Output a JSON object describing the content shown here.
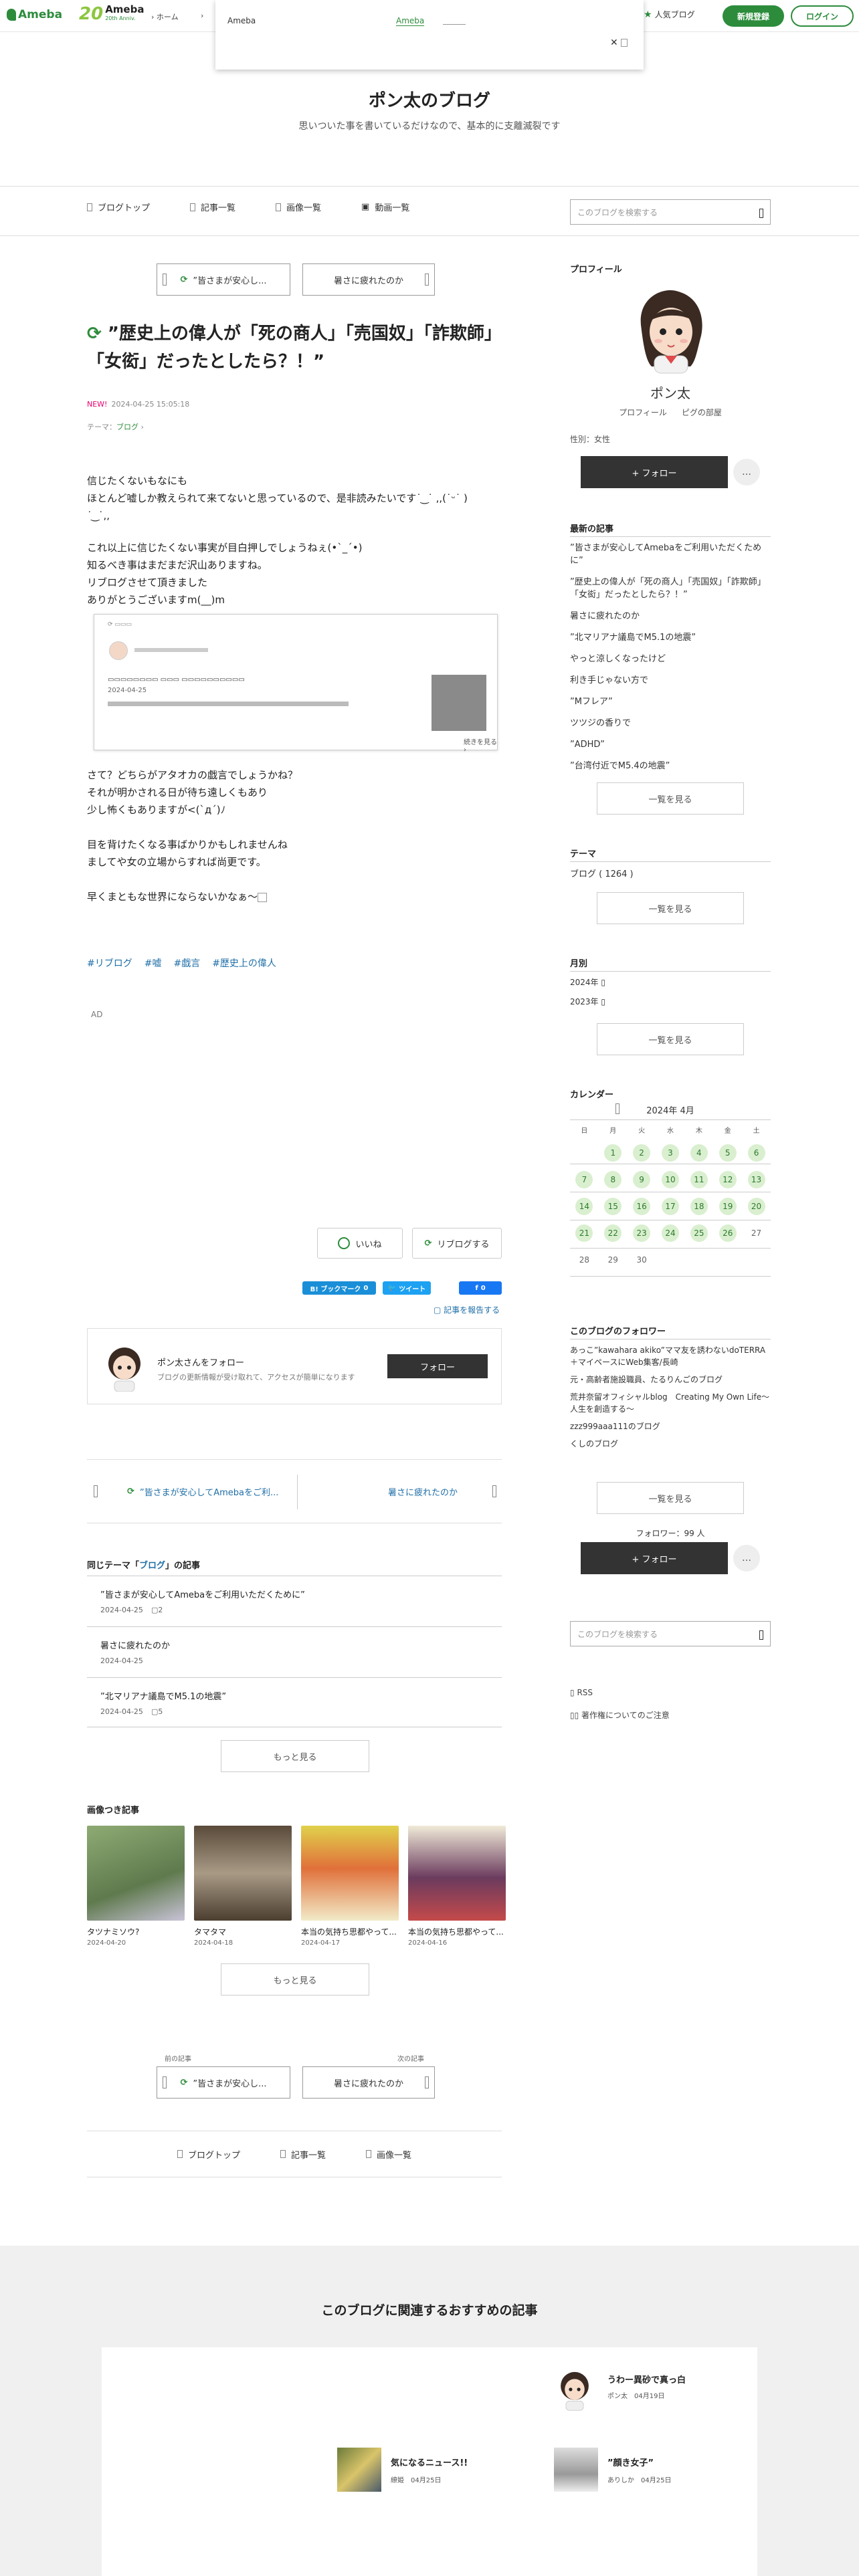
{
  "topbar": {
    "logo": "Ameba",
    "logo20_num": "20",
    "logo20_text": "Ameba",
    "logo20_sub": "20th Anniv.",
    "breadcrumb_home": "ホーム",
    "popular": "人気ブログ",
    "register": "新規登録",
    "login": "ログイン"
  },
  "popup": {
    "label": "Ameba",
    "link": "Ameba",
    "close": "✕"
  },
  "blog": {
    "title": "ポン太のブログ",
    "description": "思いついた事を書いているだけなので、基本的に支離滅裂です"
  },
  "tabs": [
    "ブログトップ",
    "記事一覧",
    "画像一覧",
    "動画一覧"
  ],
  "search_placeholder": "このブログを検索する",
  "post_nav": {
    "prev": "”皆さまが安心し...",
    "next": "暑さに疲れたのか"
  },
  "article": {
    "title": "”歴史上の偉人が「死の商人」「売国奴」「詐欺師」「女衒」だったとしたら？！”",
    "new_label": "NEW!",
    "datetime": "2024-04-25 15:05:18",
    "theme_label": "テーマ：",
    "theme": "ブログ",
    "para1": [
      "信じたくないもなにも",
      "ほとんど嘘しか教えられて来てないと思っているので、是非読みたいです˙ ͜ ˙ ,,(˙ᵕ˙ )",
      "˙ ͜ ˙,,"
    ],
    "para2": [
      "これ以上に信じたくない事実が目白押しでしょうねぇ(•`_´•)",
      "知るべき事はまだまだ沢山ありますね。",
      "リブログさせて頂きました",
      "ありがとうございますm(__)m"
    ],
    "embed_date": "2024-04-25",
    "embed_more": "続きを見る",
    "para3": [
      "さて？どちらがアタオカの戯言でしょうかね？",
      "それが明かされる日が待ち遠しくもあり",
      "少し怖くもありますが<(`д´)ﾉ"
    ],
    "para4": [
      "目を背けたくなる事ばかりかもしれませんね",
      "ましてや女の立場からすれば尚更です。"
    ],
    "para5": "早くまともな世界にならないかなぁ〜",
    "tags": [
      "#リブログ",
      "#嘘",
      "#戯言",
      "#歴史上の偉人"
    ],
    "ad": "AD"
  },
  "actions": {
    "like": "いいね",
    "reblog": "リブログする",
    "bookmark": "B! ブックマーク",
    "bookmark_count": "0",
    "tweet": "ツイート",
    "fb_count": "0",
    "report": "記事を報告する"
  },
  "followbox": {
    "name": "ポン太さんをフォロー",
    "desc": "ブログの更新情報が受け取れて、アクセスが簡単になります",
    "button": "フォロー"
  },
  "bottom_nav": {
    "prev": "”皆さまが安心してAmebaをご利...",
    "next": "暑さに疲れたのか"
  },
  "same_theme": {
    "heading_pre": "同じテーマ「",
    "heading_theme": "ブログ",
    "heading_post": "」の記事",
    "items": [
      {
        "title": "”皆さまが安心してAmebaをご利用いただくために”",
        "date": "2024-04-25",
        "count": "2"
      },
      {
        "title": "暑さに疲れたのか",
        "date": "2024-04-25",
        "count": ""
      },
      {
        "title": "”北マリアナ議島でM5.1の地震”",
        "date": "2024-04-25",
        "count": "5"
      }
    ],
    "more": "もっと見る"
  },
  "image_posts": {
    "heading": "画像つき記事",
    "items": [
      {
        "title": "タツナミソウ?",
        "date": "2024-04-20",
        "color": "#6f8b5a"
      },
      {
        "title": "タマタマ",
        "date": "2024-04-18",
        "color": "#7a6a55"
      },
      {
        "title": "本当の気持ち思都やって...",
        "date": "2024-04-17",
        "color": "#d9c94a"
      },
      {
        "title": "本当の気持ち思都やって...",
        "date": "2024-04-16",
        "color": "#6b3b5e"
      }
    ],
    "more": "もっと見る"
  },
  "foot_post_nav": {
    "prev_label": "前の記事",
    "next_label": "次の記事",
    "prev": "”皆さまが安心し...",
    "next": "暑さに疲れたのか"
  },
  "foot_tabs": [
    "ブログトップ",
    "記事一覧",
    "画像一覧"
  ],
  "recommend": {
    "title": "このブログに関連するおすすめの記事",
    "items": [
      {
        "title": "うわー異砂で真っ白",
        "author": "ポン太",
        "date": "04月19日"
      },
      {
        "title": "気になるニュース!!",
        "author": "繚姫",
        "date": "04月25日"
      },
      {
        "title": "”顔き女子”",
        "author": "ありしか",
        "date": "04月25日"
      }
    ]
  },
  "sidebar": {
    "profile_h": "プロフィール",
    "name": "ポン太",
    "profile_link": "プロフィール",
    "pigg_link": "ピグの部屋",
    "sex": "性別：女性",
    "follow": "+ フォロー",
    "dots": "…",
    "recent_h": "最新の記事",
    "recent": [
      "”皆さまが安心してAmebaをご利用いただくために”",
      "”歴史上の偉人が「死の商人」「売国奴」「詐欺師」「女衒」だったとしたら？！”",
      "暑さに疲れたのか",
      "”北マリアナ議島でM5.1の地震”",
      "やっと涼しくなったけど",
      "利き手じゃない方で",
      "”Mフレア”",
      "ツツジの香りで",
      "”ADHD”",
      "”台湾付近でM5.4の地震”"
    ],
    "recent_more": "一覧を見る",
    "theme_h": "テーマ",
    "theme_item": "ブログ ( 1264 )",
    "theme_more": "一覧を見る",
    "month_h": "月別",
    "months": [
      "2024年",
      "2023年"
    ],
    "month_more": "一覧を見る",
    "cal_h": "カレンダー",
    "cal_month": "2024年 4月",
    "weekdays": [
      "日",
      "月",
      "火",
      "水",
      "木",
      "金",
      "土"
    ],
    "followers_h": "このブログのフォロワー",
    "followers": [
      "あっこ”kawahara akiko”ママ友を誘わないdoTERRA＋マイペースにWeb集客/長崎",
      "元・高齢者施設職員、たるりんごのブログ",
      "荒井奈留オフィシャルblog　Creating My Own Life〜人生を創造する〜",
      "zzz999aaa111のブログ",
      "くしのブログ"
    ],
    "followers_more": "一覧を見る",
    "follower_count": "フォロワー：99 人",
    "follow2": "+ フォロー",
    "rss": "RSS",
    "copyright": "著作権についてのご注意"
  }
}
